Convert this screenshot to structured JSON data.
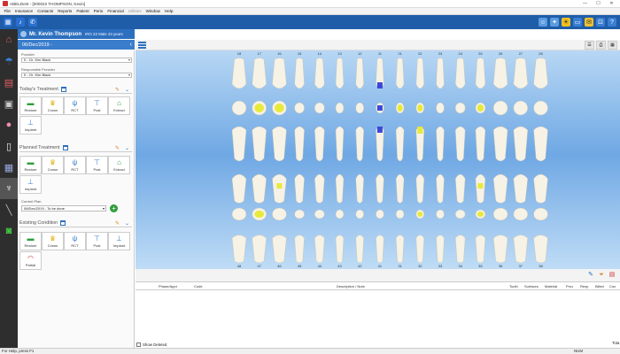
{
  "title": "ABELDent - [000022 THOMPSON, Kevin]",
  "window_controls": [
    "—",
    "☐",
    "✕"
  ],
  "menu": [
    {
      "label": "File",
      "dim": false
    },
    {
      "label": "Insurance",
      "dim": false
    },
    {
      "label": "Contacts",
      "dim": false
    },
    {
      "label": "Reports",
      "dim": false
    },
    {
      "label": "Patient",
      "dim": false
    },
    {
      "label": "Perio",
      "dim": false
    },
    {
      "label": "Financial",
      "dim": false
    },
    {
      "label": "Utilities",
      "dim": true
    },
    {
      "label": "Window",
      "dim": false
    },
    {
      "label": "Help",
      "dim": false
    }
  ],
  "patient": {
    "name": "Mr. Kevin Thompson",
    "meta": "IRO 22    Male    43 years",
    "date": "06/Dec/2019 -"
  },
  "fields": {
    "provider_label": "Provider",
    "provider_value": "K - Dr. Kim Black",
    "resp_label": "Responsible Provider",
    "resp_value": "K - Dr. Kim Black",
    "current_plan_label": "Current Plan",
    "current_plan_value": "06/Dec/2019 - To be done"
  },
  "sections": {
    "today": "Today's Treatment",
    "planned": "Planned Treatment",
    "existing": "Existing Condition"
  },
  "today_items": [
    "Restore",
    "Crown",
    "RCT",
    "Post",
    "Extract",
    "Implant"
  ],
  "planned_items": [
    "Restore",
    "Crown",
    "RCT",
    "Post",
    "Extract",
    "Implant"
  ],
  "existing_items": [
    "Restore",
    "Crown",
    "RCT",
    "Post",
    "Implant",
    "Partial"
  ],
  "upper_numbers": [
    "18",
    "17",
    "16",
    "15",
    "14",
    "13",
    "12",
    "11",
    "21",
    "22",
    "23",
    "24",
    "25",
    "26",
    "27",
    "28"
  ],
  "lower_numbers": [
    "48",
    "47",
    "46",
    "45",
    "44",
    "43",
    "42",
    "41",
    "31",
    "32",
    "33",
    "34",
    "35",
    "36",
    "37",
    "38"
  ],
  "grid_columns": [
    "Phase/Appt",
    "Code",
    "Description / Note",
    "Tooth",
    "Surfaces",
    "Material",
    "Prov",
    "Resp",
    "Billed",
    "Con"
  ],
  "show_deleted": "Show Deleted",
  "totals_label": "Tota",
  "status_left": "For Help, press F1",
  "status_right": "NUM",
  "colors": {
    "toolbar": "#1f5da8",
    "patient_bar": "#2d6fbf",
    "filling": "#e8ea3a",
    "rct_blue": "#3b47d8",
    "tooth": "#f6f2e6"
  }
}
